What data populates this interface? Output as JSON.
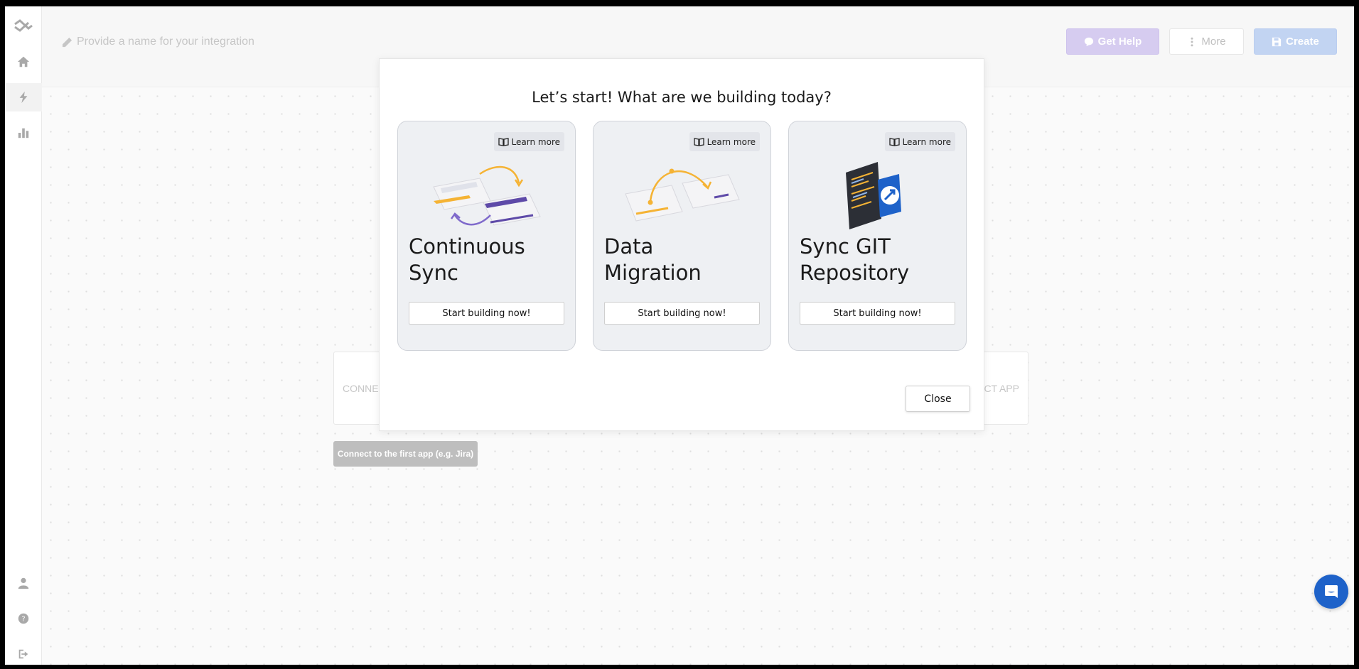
{
  "header": {
    "name_placeholder": "Provide a name for your integration",
    "get_help_label": "Get Help",
    "more_label": "More",
    "create_label": "Create"
  },
  "canvas": {
    "left_app_label": "CONNE",
    "right_app_label": "ECT APP",
    "first_app_hint": "Connect to the first app (e.g. Jira)"
  },
  "modal": {
    "title": "Let’s start! What are we building today?",
    "close_label": "Close",
    "cards": [
      {
        "learn_label": "Learn more",
        "title_line1": "Continuous",
        "title_line2": "Sync",
        "button_label": "Start building now!"
      },
      {
        "learn_label": "Learn more",
        "title_line1": "Data",
        "title_line2": "Migration",
        "button_label": "Start building now!"
      },
      {
        "learn_label": "Learn more",
        "title_line1": "Sync GIT",
        "title_line2": "Repository",
        "button_label": "Start building now!"
      }
    ]
  },
  "sidebar": {
    "icons": [
      "logo-icon",
      "home-icon",
      "bolt-icon",
      "chart-icon",
      "user-icon",
      "help-icon",
      "logout-icon"
    ]
  },
  "colors": {
    "accent_help": "#cfc3ee",
    "accent_create": "#b8cdf0",
    "chat": "#1e62c9"
  }
}
